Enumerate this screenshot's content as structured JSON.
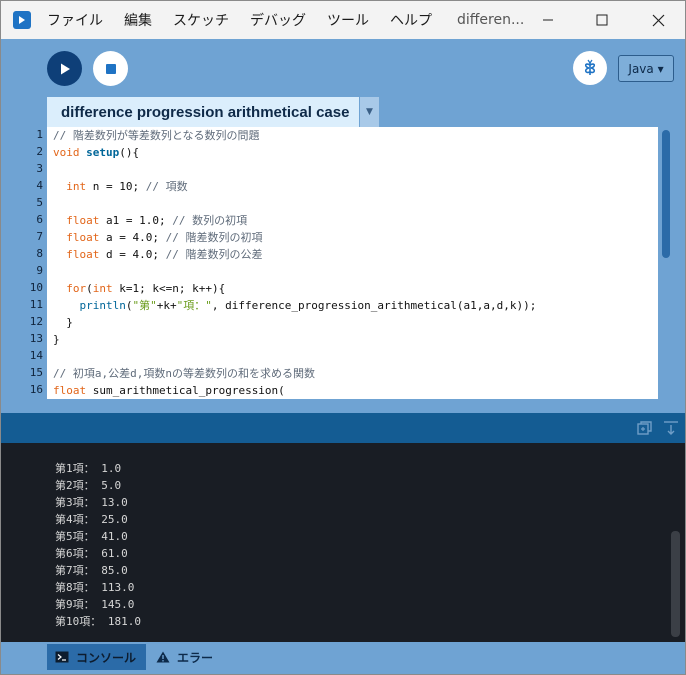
{
  "menu": {
    "items": [
      "ファイル",
      "編集",
      "スケッチ",
      "デバッグ",
      "ツール",
      "ヘルプ"
    ],
    "window_title": "differen..."
  },
  "toolbar": {
    "mode_label": "Java ▾"
  },
  "editor": {
    "tab_name": "difference progression arithmetical case",
    "line_numbers": [
      "1",
      "2",
      "3",
      "4",
      "5",
      "6",
      "7",
      "8",
      "9",
      "10",
      "11",
      "12",
      "13",
      "14",
      "15",
      "16"
    ],
    "lines": [
      "// 階差数列が等差数列となる数列の問題",
      "void setup(){",
      "",
      "  int n = 10; // 項数",
      "",
      "  float a1 = 1.0; // 数列の初項",
      "  float a = 4.0; // 階差数列の初項",
      "  float d = 4.0; // 階差数列の公差",
      "",
      "  for(int k=1; k<=n; k++){",
      "    println(\"第\"+k+\"項：\", difference_progression_arithmetical(a1,a,d,k));",
      "  }",
      "}",
      "",
      "// 初項a,公差d,項数nの等差数列の和を求める関数",
      "float sum_arithmetical_progression("
    ]
  },
  "console": {
    "output": [
      "第1項： 1.0",
      "第2項： 5.0",
      "第3項： 13.0",
      "第4項： 25.0",
      "第5項： 41.0",
      "第6項： 61.0",
      "第7項： 85.0",
      "第8項： 113.0",
      "第9項： 145.0",
      "第10項： 181.0"
    ]
  },
  "status_tabs": {
    "console_label": "コンソール",
    "errors_label": "エラー"
  },
  "colors": {
    "toolbar": "#6fa3d3",
    "run_button": "#0e3f78",
    "console_bg": "#191d24",
    "keyword": "#e2661a",
    "function": "#006699"
  }
}
